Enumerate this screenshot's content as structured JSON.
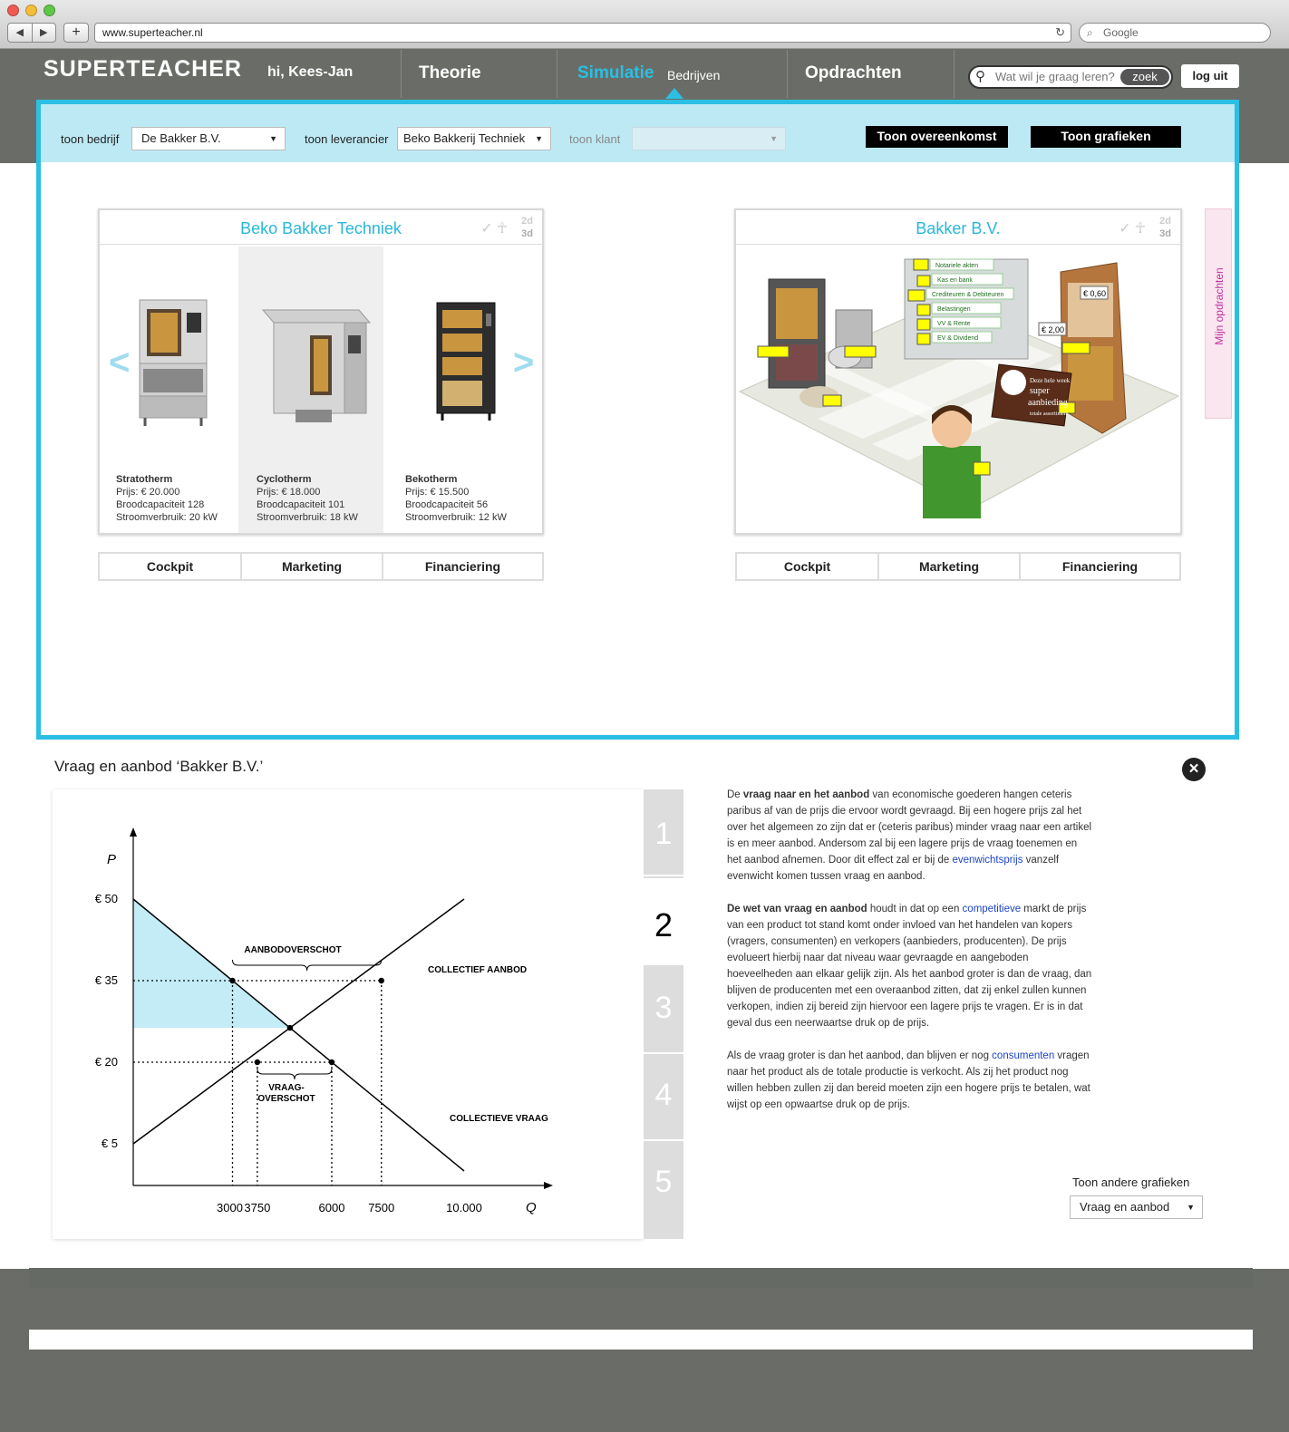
{
  "browser": {
    "url": "www.superteacher.nl",
    "search_placeholder": "Google",
    "back": "◀",
    "forward": "▶",
    "plus": "+"
  },
  "header": {
    "logo": "SUPERTEACHER",
    "greeting": "hi, Kees-Jan",
    "nav": [
      "Theorie",
      "Simulatie",
      "Opdrachten"
    ],
    "subnav": "Bedrijven",
    "search_placeholder": "Wat wil je graag leren?",
    "search_button": "zoek",
    "logout": "log uit"
  },
  "filters": {
    "bedrijf_label": "toon bedrijf",
    "bedrijf_value": "De Bakker B.V.",
    "leverancier_label": "toon leverancier",
    "leverancier_value": "Beko Bakkerij Techniek",
    "klant_label": "toon klant",
    "klant_value": "",
    "btn_overeenkomst": "Toon overeenkomst",
    "btn_grafieken": "Toon grafieken"
  },
  "card_left": {
    "title": "Beko Bakker Techniek",
    "toggle_2d": "2d",
    "toggle_3d": "3d",
    "products": [
      {
        "name": "Stratotherm",
        "price": "Prijs: € 20.000",
        "cap": "Broodcapaciteit 128",
        "power": "Stroomverbruik: 20 kW"
      },
      {
        "name": "Cyclotherm",
        "price": "Prijs: € 18.000",
        "cap": "Broodcapaciteit 101",
        "power": "Stroomverbruik: 18 kW"
      },
      {
        "name": "Bekotherm",
        "price": "Prijs: € 15.500",
        "cap": "Broodcapaciteit 56",
        "power": "Stroomverbruik: 12 kW"
      }
    ]
  },
  "card_right": {
    "title": "Bakker B.V.",
    "toggle_2d": "2d",
    "toggle_3d": "3d",
    "labels": [
      "Notariele akten",
      "Kas en bank",
      "Crediteuren & Debiteuren",
      "Belastingen",
      "VV & Rente",
      "EV & Dividend"
    ],
    "prices": [
      "€ 0,60",
      "€ 2,00"
    ],
    "sign": [
      "Deze hele week",
      "super",
      "aanbieding",
      "totale assortiment"
    ]
  },
  "tabs": [
    "Cockpit",
    "Marketing",
    "Financiering"
  ],
  "side_tab": "Mijn opdrachten",
  "graph": {
    "title": "Vraag en aanbod ‘Bakker B.V.’",
    "steps": [
      "1",
      "2",
      "3",
      "4",
      "5"
    ],
    "active_step": 2,
    "paragraphs": [
      [
        "De ",
        "vraag naar en het aanbod",
        " van economische goederen hangen ceteris paribus af van de prijs die ervoor wordt gevraagd. Bij een hogere prijs zal het over het algemeen zo zijn dat er (ceteris paribus) minder vraag naar een artikel is en meer aanbod. Andersom zal bij een lagere prijs de vraag toenemen en het aanbod afnemen. Door dit effect zal er bij de ",
        "evenwichtsprijs",
        " vanzelf evenwicht komen tussen vraag en aanbod."
      ],
      [
        "",
        "De wet van vraag en aanbod",
        " houdt in dat op een ",
        "competitieve",
        " markt de prijs van een product tot stand komt onder invloed van het handelen van kopers (vragers, consumenten) en verkopers (aanbieders, producenten). De prijs evolueert hierbij naar dat niveau waar gevraagde en aangeboden hoeveelheden aan elkaar gelijk zijn. Als het aanbod groter is dan de vraag, dan blijven de producenten met een overaanbod zitten, dat zij enkel zullen kunnen verkopen, indien zij bereid zijn hiervoor een lagere prijs te vragen. Er is in dat geval dus een neerwaartse druk op de prijs."
      ],
      [
        "Als de vraag groter is dan het aanbod, dan blijven er nog ",
        "consumenten",
        " vragen naar het product als de totale productie is verkocht. Als zij het product nog willen hebben zullen zij dan bereid moeten zijn een hogere prijs te betalen, wat wijst op een opwaartse druk op de prijs."
      ]
    ],
    "other_label": "Toon andere grafieken",
    "other_value": "Vraag en aanbod"
  },
  "chart_data": {
    "type": "line",
    "ylabel": "P",
    "xlabel": "Q",
    "y_ticks": [
      "€ 50",
      "€ 35",
      "€ 20",
      "€ 5"
    ],
    "y_values": [
      50,
      35,
      20,
      5
    ],
    "x_ticks": [
      "3000",
      "3750",
      "6000",
      "7500",
      "10.000"
    ],
    "x_values": [
      3000,
      3750,
      6000,
      7500,
      10000
    ],
    "series": [
      {
        "name": "COLLECTIEF AANBOD",
        "points": [
          [
            0,
            5
          ],
          [
            10000,
            50
          ]
        ]
      },
      {
        "name": "COLLECTIEVE VRAAG",
        "points": [
          [
            0,
            50
          ],
          [
            10000,
            0
          ]
        ]
      }
    ],
    "annotations": [
      "AANBODOVERSCHOT",
      "VRAAG-",
      "OVERSCHOT"
    ],
    "shaded_area": "consumentensurplus"
  }
}
